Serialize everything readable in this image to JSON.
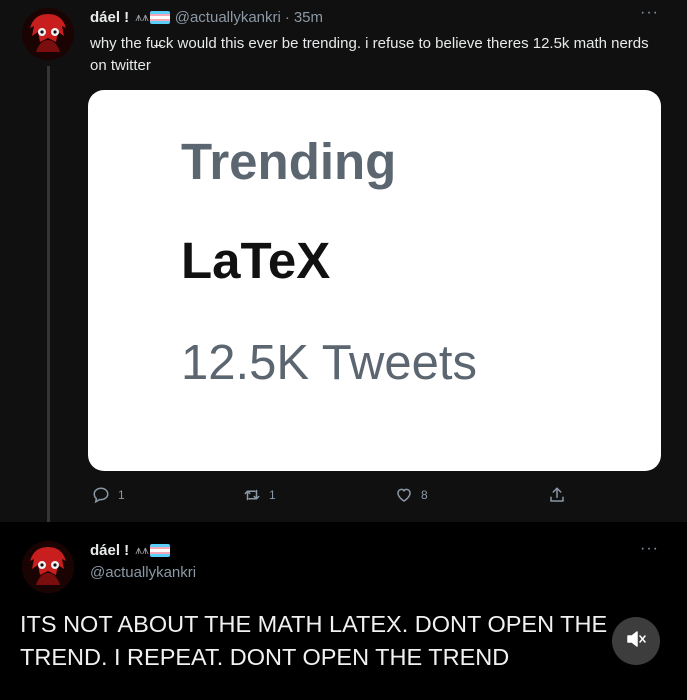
{
  "tweet1": {
    "display_name": "dáel !",
    "handle": "@actuallykankri",
    "separator": "·",
    "time": "35m",
    "more_label": "···",
    "text": "why the fu̶ck would this ever be trending. i refuse to believe theres 12.5k math nerds on twitter",
    "card": {
      "title": "Trending",
      "topic": "LaTeX",
      "count": "12.5K Tweets"
    },
    "actions": {
      "reply_count": "1",
      "retweet_count": "1",
      "like_count": "8"
    }
  },
  "tweet2": {
    "display_name": "dáel !",
    "handle": "@actuallykankri",
    "more_label": "···",
    "text": "ITS NOT ABOUT THE MATH LATEX. DONT OPEN THE TREND. I REPEAT. DONT OPEN THE TREND"
  },
  "flag_colors": [
    "#5bcefa",
    "#f5a9b8",
    "#ffffff",
    "#f5a9b8",
    "#5bcefa"
  ],
  "icons": {
    "reply": "reply-icon",
    "retweet": "retweet-icon",
    "like": "heart-icon",
    "share": "share-icon",
    "mute": "muted-speaker-icon"
  }
}
